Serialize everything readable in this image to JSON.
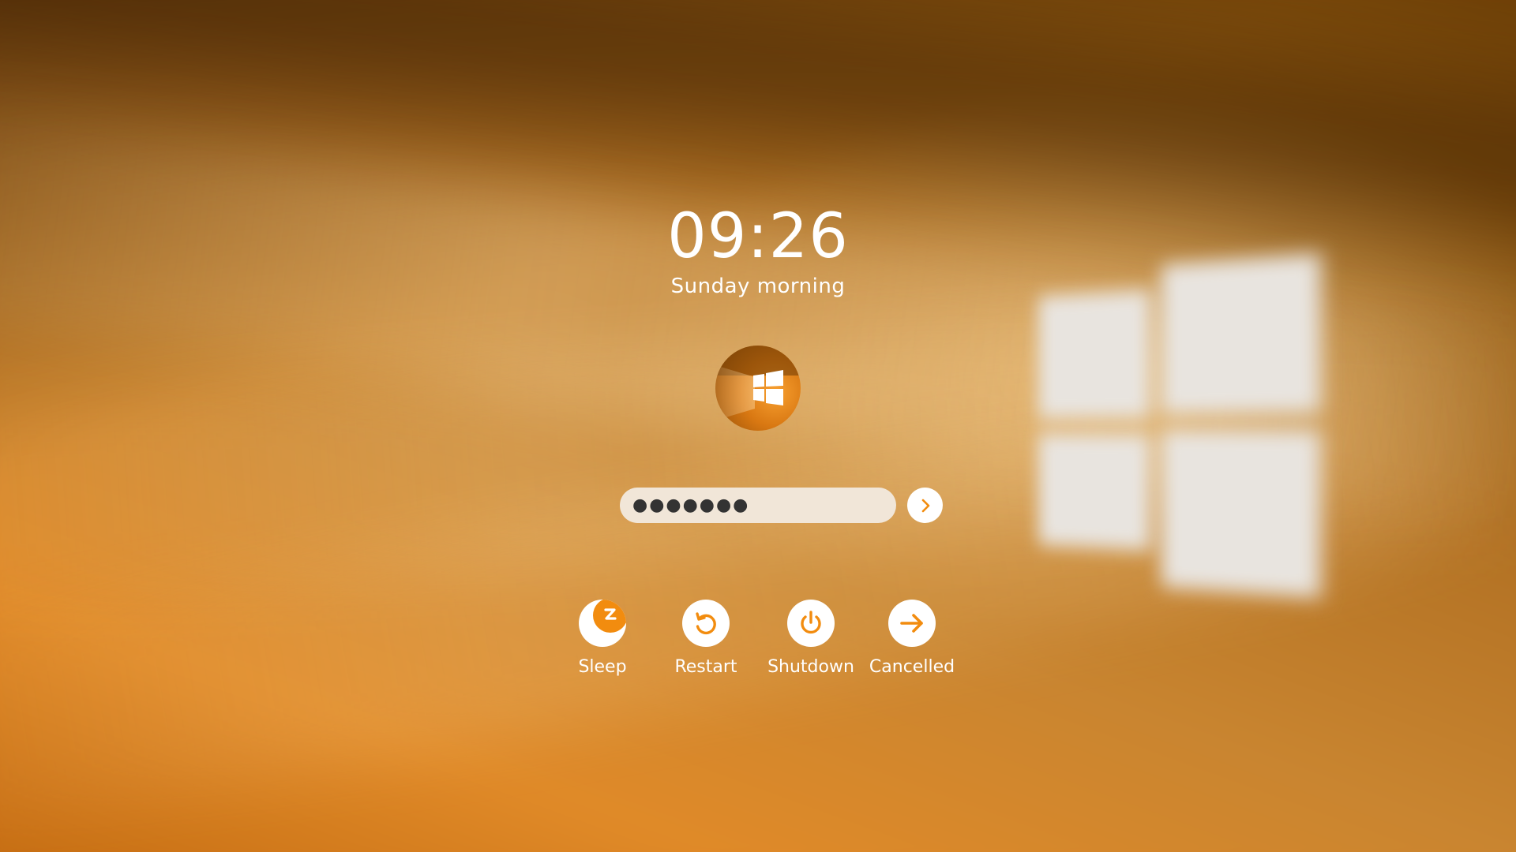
{
  "lock_screen": {
    "clock": "09:26",
    "greeting": "Sunday morning",
    "avatar_icon": "windows-logo-icon"
  },
  "login": {
    "password_mask": "●●●●●●●",
    "password_length": 7,
    "submit_icon": "chevron-right-icon"
  },
  "power_options": [
    {
      "label": "Sleep",
      "icon": "sleep-icon"
    },
    {
      "label": "Restart",
      "icon": "restart-icon"
    },
    {
      "label": "Shutdown",
      "icon": "power-icon"
    },
    {
      "label": "Cancelled",
      "icon": "arrow-right-icon"
    }
  ],
  "colors": {
    "accent": "#F28C0F",
    "text": "#FFFFFF",
    "input_background": "#F1E6D8",
    "icon_background": "#FFFFFF"
  }
}
